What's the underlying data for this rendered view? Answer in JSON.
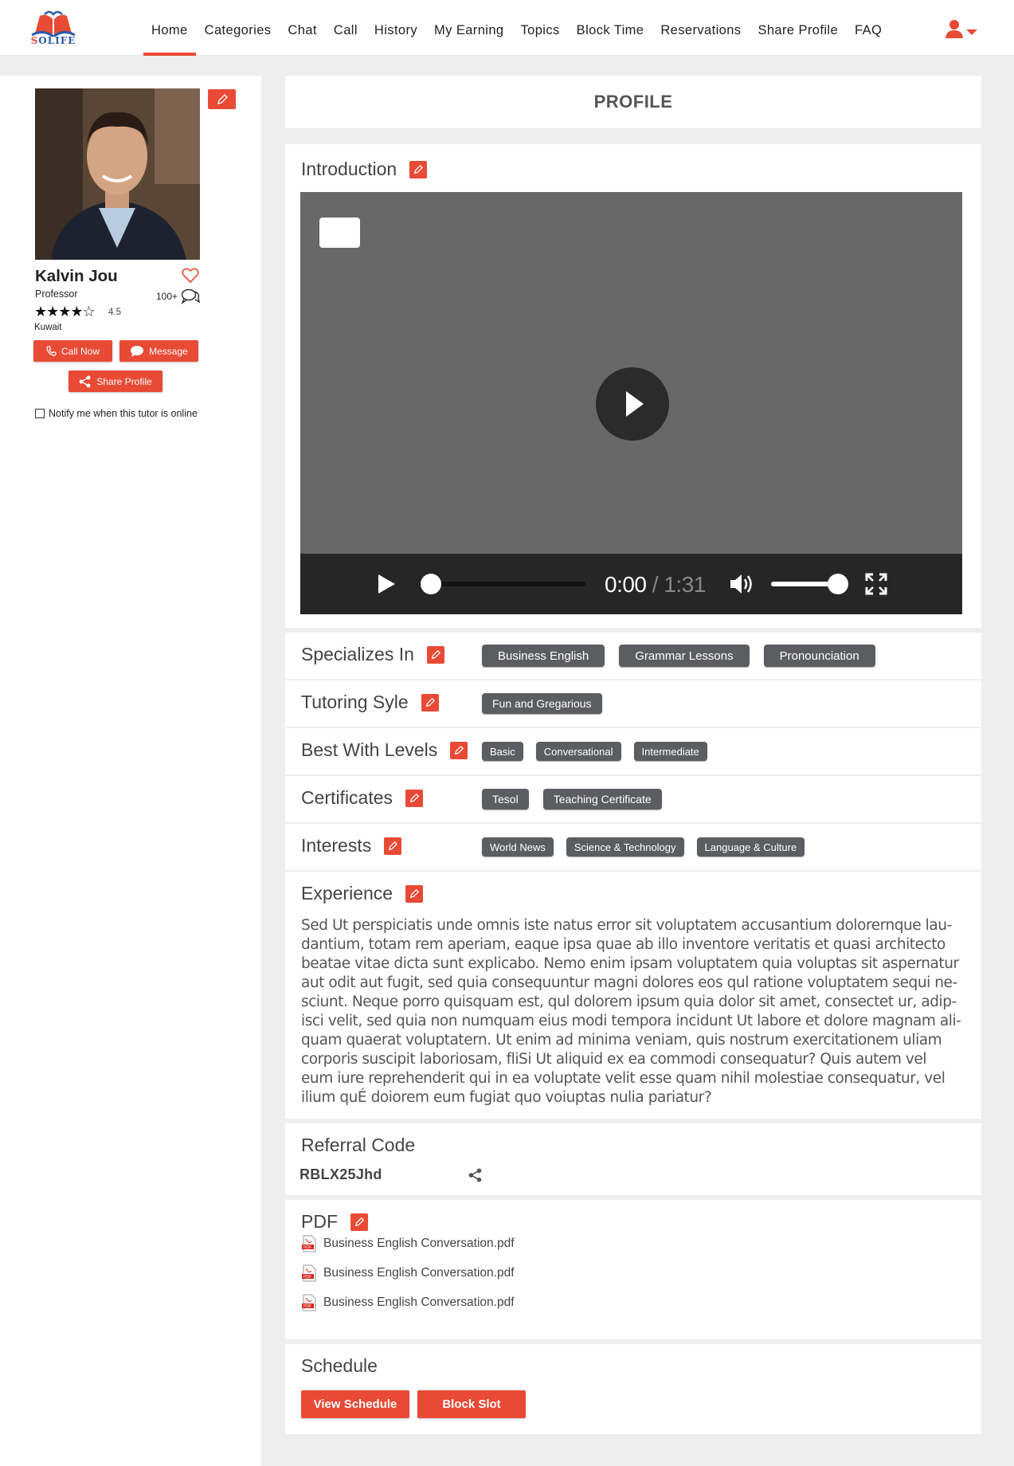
{
  "brand": {
    "logo_text_s": "S",
    "logo_text_rest": "OLIFE",
    "accent_color": "#e84a35",
    "logo_blue": "#2a5ba8"
  },
  "nav": {
    "items": [
      "Home",
      "Categories",
      "Chat",
      "Call",
      "History",
      "My Earning",
      "Topics",
      "Block Time",
      "Reservations",
      "Share Profile",
      "FAQ"
    ],
    "active": "Home"
  },
  "tutor": {
    "name": "Kalvin Jou",
    "title": "Professor",
    "rating": "4.5",
    "stars_display": "★★★★☆",
    "location": "Kuwait",
    "review_count": "100+",
    "call_label": "Call Now",
    "message_label": "Message",
    "share_label": "Share Profile",
    "notify_label": "Notify me when this tutor is online",
    "notify_checked": false
  },
  "profile": {
    "heading": "PROFILE"
  },
  "intro": {
    "title": "Introduction",
    "video": {
      "current_time": "0:00",
      "separator": " / ",
      "duration": "1:31",
      "progress": 0.0,
      "volume": 0.85
    }
  },
  "sections": {
    "specializes": {
      "title": "Specializes In",
      "tags": [
        "Business English",
        "Grammar Lessons",
        "Pronounciation"
      ]
    },
    "style": {
      "title": "Tutoring Syle",
      "tags": [
        "Fun and Gregarious"
      ]
    },
    "levels": {
      "title": "Best With Levels",
      "tags": [
        "Basic",
        "Conversational",
        "Intermediate"
      ]
    },
    "certificates": {
      "title": "Certificates",
      "tags": [
        "Tesol",
        "Teaching Certificate"
      ]
    },
    "interests": {
      "title": "Interests",
      "tags": [
        "World News",
        "Science & Technology",
        "Language & Culture"
      ]
    }
  },
  "experience": {
    "title": "Experience",
    "lines": [
      "Sed Ut perspiciatis unde omnis iste natus error sit voluptatem accusantium dolorernque lau-",
      "dantium, totam rem aperiam, eaque ipsa quae ab illo inventore veritatis et quasi architecto",
      "beatae vitae dicta sunt explicabo. Nemo enim ipsam voluptatem quia voluptas sit aspernatur",
      "aut odit aut fugit, sed quia consequuntur magni dolores eos qul ratione voluptatem sequi ne-",
      "sciunt. Neque porro quisquam est, qul dolorem ipsum quia dolor sit amet, consectet ur, adip-",
      "isci velit, sed quia non numquam eius modi tempora incidunt Ut labore et dolore magnam ali-",
      "quam quaerat voluptatern. Ut enim ad minima veniam, quis nostrum exercitationem uliam",
      "corporis suscipit laboriosam, fliSi Ut aliquid ex ea commodi consequatur? Quis autem vel",
      "eum iure reprehenderit qui in ea voluptate velit esse quam nihil molestiae consequatur, vel",
      "ilium quÉ doiorem eum fugiat quo voiuptas nulia pariatur?"
    ]
  },
  "referral": {
    "title": "Referral Code",
    "code": "RBLX25Jhd"
  },
  "pdf": {
    "title": "PDF",
    "files": [
      "Business English Conversation.pdf",
      "Business English Conversation.pdf",
      "Business English Conversation.pdf"
    ]
  },
  "schedule": {
    "title": "Schedule",
    "view_label": "View Schedule",
    "block_label": "Block Slot"
  }
}
